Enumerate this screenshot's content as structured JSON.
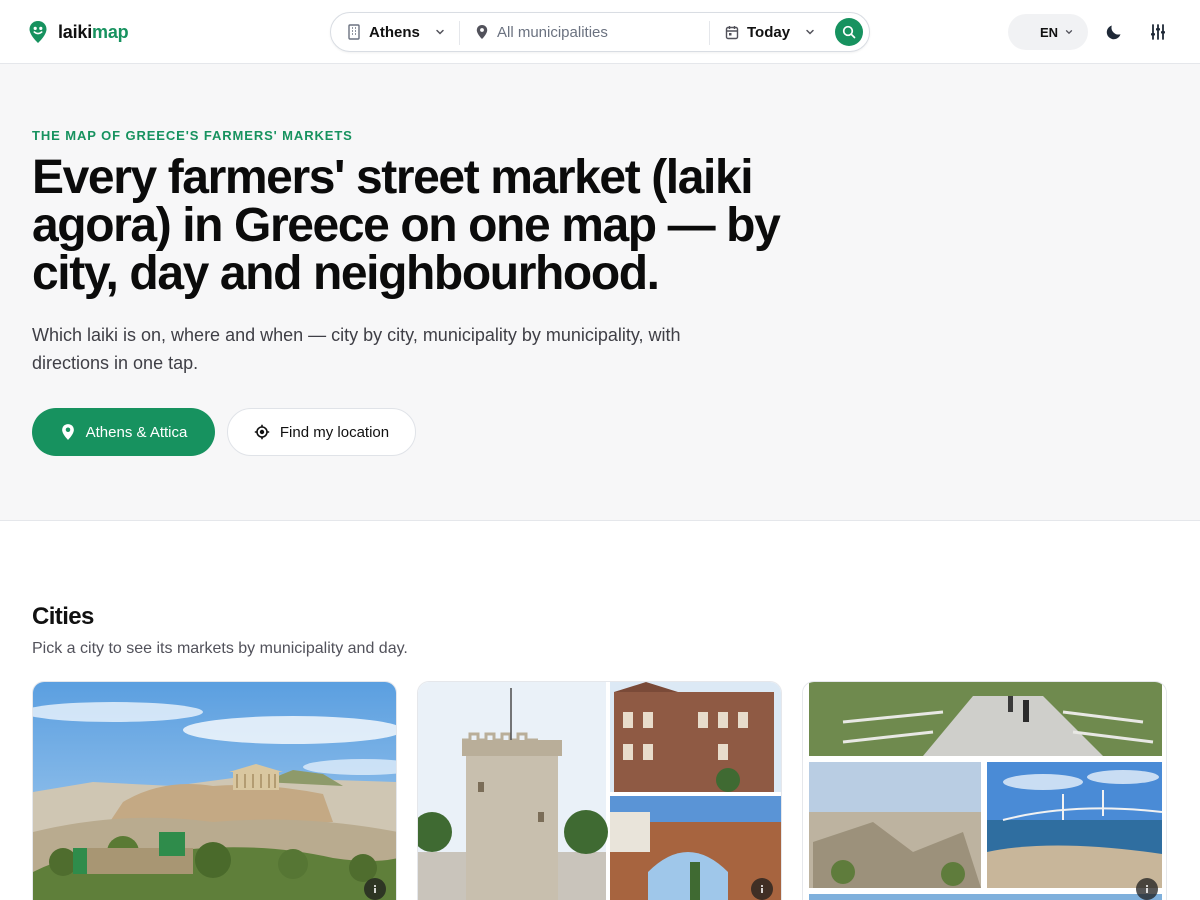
{
  "brand": {
    "name_part1": "laiki",
    "name_part2": "map",
    "accent": "#17925f"
  },
  "search": {
    "city_value": "Athens",
    "municipality_placeholder": "All municipalities",
    "day_value": "Today",
    "city_icon": "building-icon",
    "municipality_icon": "map-pin-icon",
    "day_icon": "calendar-icon",
    "submit_icon": "search-icon"
  },
  "header_controls": {
    "language": "EN",
    "theme_icon": "moon-icon",
    "filters_icon": "sliders-icon"
  },
  "hero": {
    "eyebrow": "THE MAP OF GREECE'S FARMERS' MARKETS",
    "title": "Every farmers' street market (laiki agora) in Greece on one map — by city, day and neighbourhood.",
    "subtitle": "Which laiki is on, where and when — city by city, municipality by municipality, with directions in one tap.",
    "primary_button": "Athens & Attica",
    "secondary_button": "Find my location"
  },
  "cities": {
    "title": "Cities",
    "subtitle": "Pick a city to see its markets by municipality and day.",
    "cards": [
      {
        "image": "acropolis-photo",
        "info_icon": "info-icon"
      },
      {
        "image": "white-tower-collage-photo",
        "info_icon": "info-icon"
      },
      {
        "image": "patras-collage-photo",
        "info_icon": "info-icon"
      }
    ]
  }
}
